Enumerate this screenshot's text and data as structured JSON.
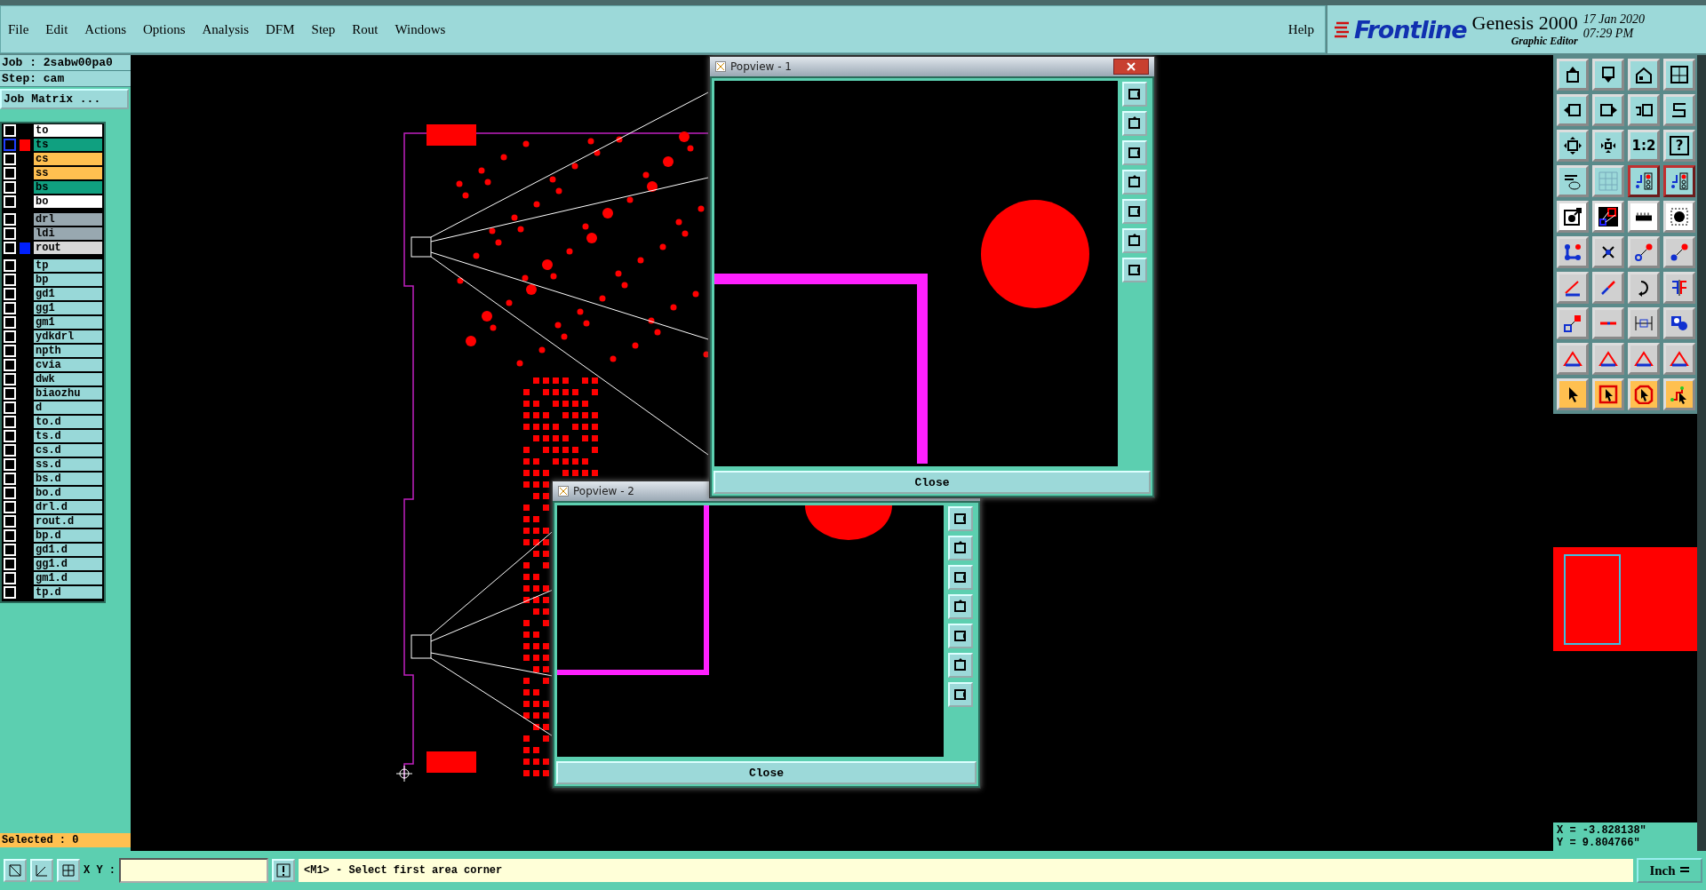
{
  "menu": [
    {
      "label": "File"
    },
    {
      "label": "Edit"
    },
    {
      "label": "Actions"
    },
    {
      "label": "Options"
    },
    {
      "label": "Analysis"
    },
    {
      "label": "DFM"
    },
    {
      "label": "Step"
    },
    {
      "label": "Rout"
    },
    {
      "label": "Windows"
    }
  ],
  "help": "Help",
  "brand": {
    "logo": "Frontline",
    "product": "Genesis 2000",
    "date": "17 Jan 2020",
    "time": "07:29 PM",
    "subtitle": "Graphic Editor"
  },
  "job": {
    "job": "Job : 2sabw00pa0",
    "step": "Step: cam",
    "matrix_button": "Job Matrix ..."
  },
  "layer_groups": [
    [
      {
        "name": "to",
        "color": "#ffffff",
        "checked": false,
        "selected": false
      },
      {
        "name": "ts",
        "color": "#10a080",
        "checked": false,
        "selected": true,
        "work_layer": true
      },
      {
        "name": "cs",
        "color": "#ffc050",
        "checked": false,
        "selected": false
      },
      {
        "name": "ss",
        "color": "#ffc050",
        "checked": false,
        "selected": false
      },
      {
        "name": "bs",
        "color": "#10a080",
        "checked": false,
        "selected": false
      },
      {
        "name": "bo",
        "color": "#ffffff",
        "checked": false,
        "selected": false
      }
    ],
    [
      {
        "name": "drl",
        "color": "#98a8b0",
        "checked": false,
        "selected": false
      },
      {
        "name": "ldi",
        "color": "#98a8b0",
        "checked": false,
        "selected": false
      },
      {
        "name": "rout",
        "color": "#d8d8d8",
        "checked": false,
        "selected": false,
        "highlighted": true
      }
    ],
    [
      {
        "name": "tp",
        "color": "#98d8d8",
        "checked": false,
        "selected": false
      },
      {
        "name": "bp",
        "color": "#98d8d8",
        "checked": false,
        "selected": false
      },
      {
        "name": "gd1",
        "color": "#98d8d8",
        "checked": false,
        "selected": false
      },
      {
        "name": "gg1",
        "color": "#98d8d8",
        "checked": false,
        "selected": false
      },
      {
        "name": "gm1",
        "color": "#98d8d8",
        "checked": false,
        "selected": false
      },
      {
        "name": "ydkdrl",
        "color": "#98d8d8",
        "checked": false,
        "selected": false
      },
      {
        "name": "npth",
        "color": "#98d8d8",
        "checked": false,
        "selected": false
      },
      {
        "name": "cvia",
        "color": "#98d8d8",
        "checked": false,
        "selected": false
      },
      {
        "name": "dwk",
        "color": "#98d8d8",
        "checked": false,
        "selected": false
      },
      {
        "name": "biaozhu",
        "color": "#98d8d8",
        "checked": false,
        "selected": false
      },
      {
        "name": "d",
        "color": "#98d8d8",
        "checked": false,
        "selected": false
      },
      {
        "name": "to.d",
        "color": "#98d8d8",
        "checked": false,
        "selected": false
      },
      {
        "name": "ts.d",
        "color": "#98d8d8",
        "checked": false,
        "selected": false
      },
      {
        "name": "cs.d",
        "color": "#98d8d8",
        "checked": false,
        "selected": false
      },
      {
        "name": "ss.d",
        "color": "#98d8d8",
        "checked": false,
        "selected": false
      },
      {
        "name": "bs.d",
        "color": "#98d8d8",
        "checked": false,
        "selected": false
      },
      {
        "name": "bo.d",
        "color": "#98d8d8",
        "checked": false,
        "selected": false
      },
      {
        "name": "drl.d",
        "color": "#98d8d8",
        "checked": false,
        "selected": false
      },
      {
        "name": "rout.d",
        "color": "#98d8d8",
        "checked": false,
        "selected": false
      },
      {
        "name": "bp.d",
        "color": "#98d8d8",
        "checked": false,
        "selected": false
      },
      {
        "name": "gd1.d",
        "color": "#98d8d8",
        "checked": false,
        "selected": false
      },
      {
        "name": "gg1.d",
        "color": "#98d8d8",
        "checked": false,
        "selected": false
      },
      {
        "name": "gm1.d",
        "color": "#98d8d8",
        "checked": false,
        "selected": false
      },
      {
        "name": "tp.d",
        "color": "#98d8d8",
        "checked": false,
        "selected": false
      }
    ]
  ],
  "selected_count": "Selected : 0",
  "popviews": [
    {
      "title": "Popview - 1",
      "close": "Close"
    },
    {
      "title": "Popview - 2",
      "close": "Close"
    }
  ],
  "tools": {
    "ratio": "1:2",
    "help": "?"
  },
  "coordinates": {
    "x": "X = -3.828138\"",
    "y": "Y = 9.804766\""
  },
  "status": {
    "xy_label": "X Y :",
    "message": "<M1> - Select first area corner",
    "units": "Inch"
  }
}
